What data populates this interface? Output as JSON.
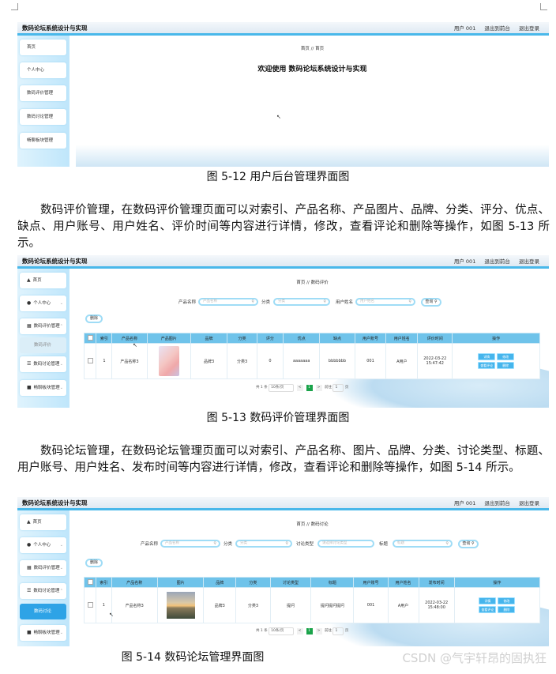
{
  "shot1": {
    "app_title": "数码论坛系统设计与实现",
    "top_links": [
      "用户 001",
      "退出到前台",
      "退出登录"
    ],
    "menu": [
      "首页",
      "个人中心",
      "数码评价管理",
      "数码讨论管理",
      "畅聊板块管理"
    ],
    "breadcrumb": "首页 // 首页",
    "welcome": "欢迎使用 数码论坛系统设计与实现"
  },
  "caption1": "图 5-12 用户后台管理界面图",
  "para1": "数码评价管理，在数码评价管理页面可以对索引、产品名称、产品图片、品牌、分类、评分、优点、缺点、用户账号、用户姓名、评价时间等内容进行详情，修改，查看评论和删除等操作，如图 5-13 所示。",
  "shot2": {
    "app_title": "数码论坛系统设计与实现",
    "top_links": [
      "用户 001",
      "退出到前台",
      "退出登录"
    ],
    "menu": [
      "首页",
      "个人中心",
      "数码评价管理",
      "数码评价",
      "数码讨论管理",
      "畅聊板块管理"
    ],
    "breadcrumb": "首页 // 数码评价",
    "filters": {
      "product_label": "产品名称",
      "product_ph": "产品名称",
      "category_label": "分类",
      "category_ph": "分类",
      "user_label": "用户姓名",
      "user_ph": "用户姓名",
      "search": "查询"
    },
    "delete_btn": "删除",
    "columns": [
      "索引",
      "产品名称",
      "产品图片",
      "品牌",
      "分类",
      "评分",
      "优点",
      "缺点",
      "用户账号",
      "用户姓名",
      "评价时间",
      "操作"
    ],
    "row": {
      "index": "1",
      "name": "产品名称3",
      "brand": "品牌3",
      "category": "分类3",
      "score": "0",
      "pros": "aaaaaaa",
      "cons": "bbbbbbb",
      "account": "001",
      "username": "A用户",
      "time": "2022-03-22 15:47:42"
    },
    "ops": [
      "详情",
      "修改",
      "查看评论",
      "删除"
    ],
    "pager": {
      "total": "共 1 条",
      "per_page": "10条/页",
      "page": "1",
      "goto": "前往",
      "goto_page": "1",
      "unit": "页"
    }
  },
  "caption2": "图 5-13 数码评价管理界面图",
  "para2": "数码论坛管理，在数码论坛管理页面可以对索引、产品名称、图片、品牌、分类、讨论类型、标题、用户账号、用户姓名、发布时间等内容进行详情，修改，查看评论和删除等操作，如图 5-14 所示。",
  "shot3": {
    "app_title": "数码论坛系统设计与实现",
    "top_links": [
      "用户 001",
      "退出到前台",
      "退出登录"
    ],
    "menu": [
      "首页",
      "个人中心",
      "数码评价管理",
      "数码讨论管理",
      "数码讨论",
      "畅聊板块管理"
    ],
    "breadcrumb": "首页 // 数码讨论",
    "filters": {
      "product_label": "产品名称",
      "product_ph": "产品名称",
      "category_label": "分类",
      "category_ph": "分类",
      "type_label": "讨论类型",
      "type_ph": "请选择讨论类型",
      "title_label": "标题",
      "title_ph": "标题",
      "search": "查询"
    },
    "delete_btn": "删除",
    "columns": [
      "索引",
      "产品名称",
      "图片",
      "品牌",
      "分类",
      "讨论类型",
      "标题",
      "用户账号",
      "用户姓名",
      "发布时间",
      "操作"
    ],
    "row": {
      "index": "1",
      "name": "产品名称3",
      "brand": "品牌3",
      "category": "分类3",
      "type": "提问",
      "title": "提问提问提问",
      "account": "001",
      "username": "A用户",
      "time": "2022-03-22 15:48:00"
    },
    "ops": [
      "详情",
      "修改",
      "查看评论",
      "删除"
    ],
    "pager": {
      "total": "共 1 条",
      "per_page": "10条/页",
      "page": "1",
      "goto": "前往",
      "goto_page": "1",
      "unit": "页"
    }
  },
  "caption3": "图 5-14 数码论坛管理界面图",
  "watermark": "CSDN @气宇轩昂的固执狂"
}
